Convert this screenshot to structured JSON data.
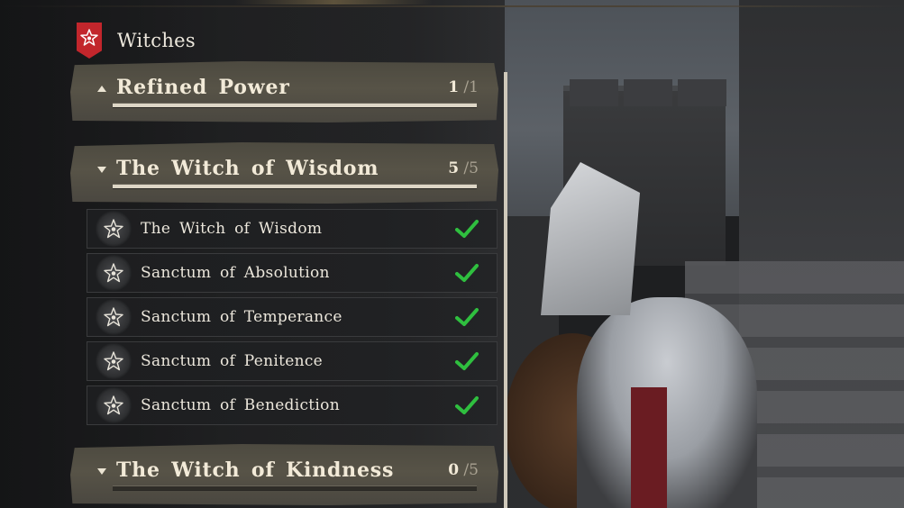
{
  "header": {
    "title": "Witches",
    "icon": "witch-crest-icon",
    "crest_color": "#c2262c"
  },
  "categories": [
    {
      "title": "Refined Power",
      "collapsed": true,
      "completed": "1",
      "total": "1",
      "progress": 1.0
    },
    {
      "title": "The Witch of Wisdom",
      "collapsed": false,
      "completed": "5",
      "total": "5",
      "progress": 1.0
    },
    {
      "title": "The Witch of Kindness",
      "collapsed": false,
      "completed": "0",
      "total": "5",
      "progress": 0.0
    }
  ],
  "entries": [
    {
      "label": "The Witch of Wisdom",
      "done": true
    },
    {
      "label": "Sanctum of Absolution",
      "done": true
    },
    {
      "label": "Sanctum of Temperance",
      "done": true
    },
    {
      "label": "Sanctum of Penitence",
      "done": true
    },
    {
      "label": "Sanctum of Benediction",
      "done": true
    }
  ],
  "colors": {
    "check": "#2fbf3f",
    "accent_red": "#c2262c",
    "text": "#ece7dc"
  }
}
